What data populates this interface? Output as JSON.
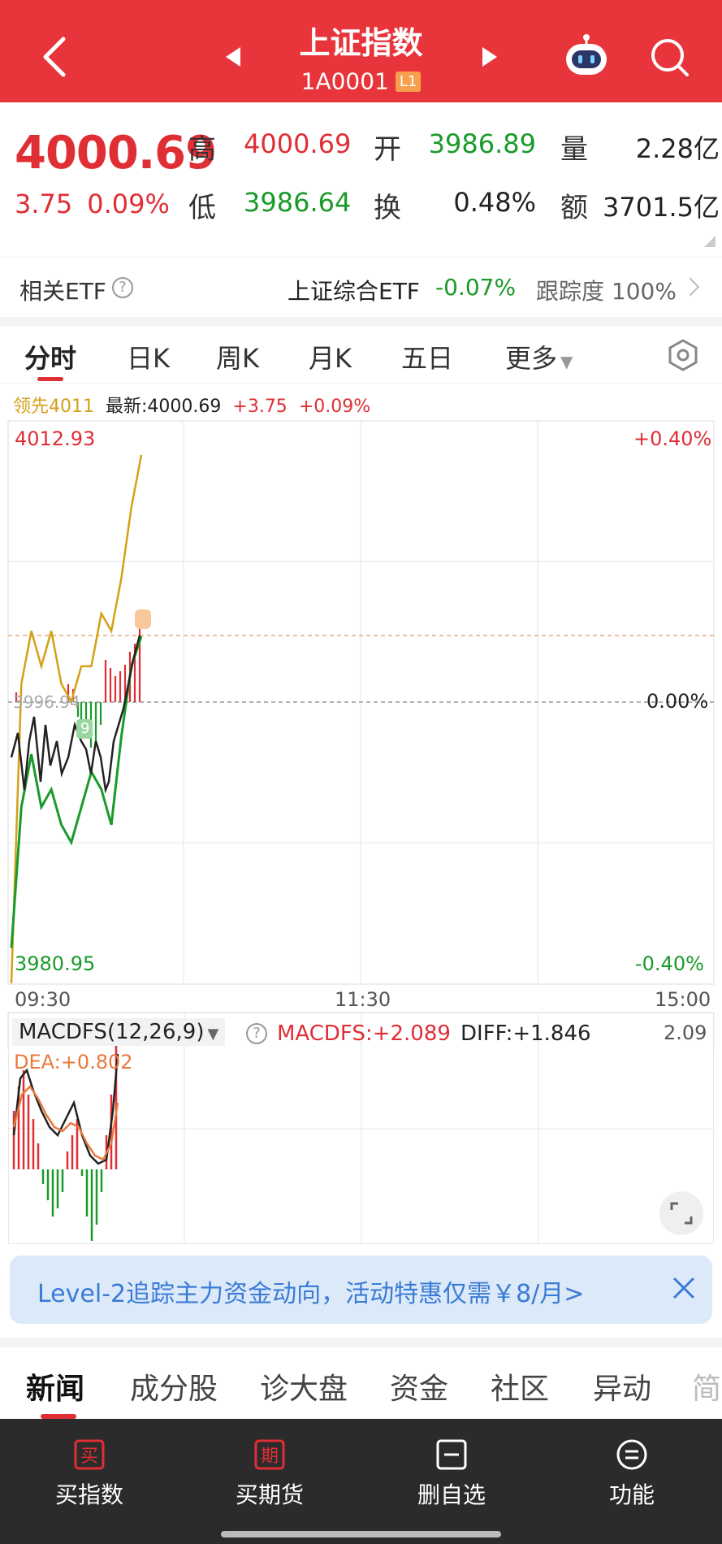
{
  "header": {
    "title": "上证指数",
    "code": "1A0001",
    "level_badge": "L1"
  },
  "quote": {
    "price": "4000.69",
    "change": "3.75",
    "change_pct": "0.09%",
    "high_label": "高",
    "high": "4000.69",
    "low_label": "低",
    "low": "3986.64",
    "open_label": "开",
    "open": "3986.89",
    "turnover_label": "换",
    "turnover": "0.48%",
    "volume_label": "量",
    "volume": "2.28亿",
    "amount_label": "额",
    "amount": "3701.5亿"
  },
  "etf": {
    "label": "相关ETF",
    "name": "上证综合ETF",
    "change": "-0.07%",
    "tracking": "跟踪度 100%"
  },
  "tabs": [
    "分时",
    "日K",
    "周K",
    "月K",
    "五日",
    "更多"
  ],
  "legend": {
    "lead": "领先4011",
    "latest": "最新:4000.69",
    "change": "+3.75",
    "change_pct": "+0.09%"
  },
  "chart_labels": {
    "y_top": "4012.93",
    "y_bottom": "3980.95",
    "pct_top": "+0.40%",
    "pct_mid": "0.00%",
    "pct_bottom": "-0.40%",
    "x_start": "09:30",
    "x_mid": "11:30",
    "x_end": "15:00",
    "prev_close_label": "3996.94",
    "marker": "9"
  },
  "macd": {
    "selector": "MACDFS(12,26,9)",
    "macdfs": "MACDFS:+2.089",
    "diff": "DIFF:+1.846",
    "dea": "DEA:+0.802",
    "max": "2.09"
  },
  "chart_data": {
    "type": "line",
    "title": "",
    "x": [
      "09:30",
      "09:35",
      "09:40",
      "09:45",
      "09:50",
      "09:55",
      "10:00",
      "10:05",
      "10:10",
      "10:15",
      "10:20",
      "10:25",
      "10:30",
      "10:35"
    ],
    "series": [
      {
        "values": [
          3983,
          3991,
          3994,
          3991,
          3992,
          3990,
          3989,
          3991,
          3993,
          3992,
          3990,
          3995,
          3999,
          4000.69
        ]
      },
      {
        "name": "领先4011",
        "values": [
          3981,
          3998,
          4001,
          3999,
          4001,
          3998,
          3997,
          3999,
          3999,
          4002,
          4001,
          4004,
          4008,
          4011
        ]
      }
    ],
    "ylim": [
      3980.95,
      4012.93
    ],
    "prev_close": 3996.94,
    "xticks": [
      "09:30",
      "11:30",
      "15:00"
    ]
  },
  "promo": {
    "text": "Level-2追踪主力资金动向，活动特惠仅需￥8/月>"
  },
  "news_tabs": [
    "新闻",
    "成分股",
    "诊大盘",
    "资金",
    "社区",
    "异动",
    "简"
  ],
  "bottom_nav": [
    {
      "label": "买指数",
      "icon_char": "买"
    },
    {
      "label": "买期货",
      "icon_char": "期"
    },
    {
      "label": "删自选",
      "icon_char": ""
    },
    {
      "label": "功能",
      "icon_char": ""
    }
  ],
  "colors": {
    "header_bg": "#e8343b",
    "up": "#e02e35",
    "down": "#1a9a2a",
    "lead_line": "#d4a017",
    "promo_text": "#3a7bd5"
  }
}
